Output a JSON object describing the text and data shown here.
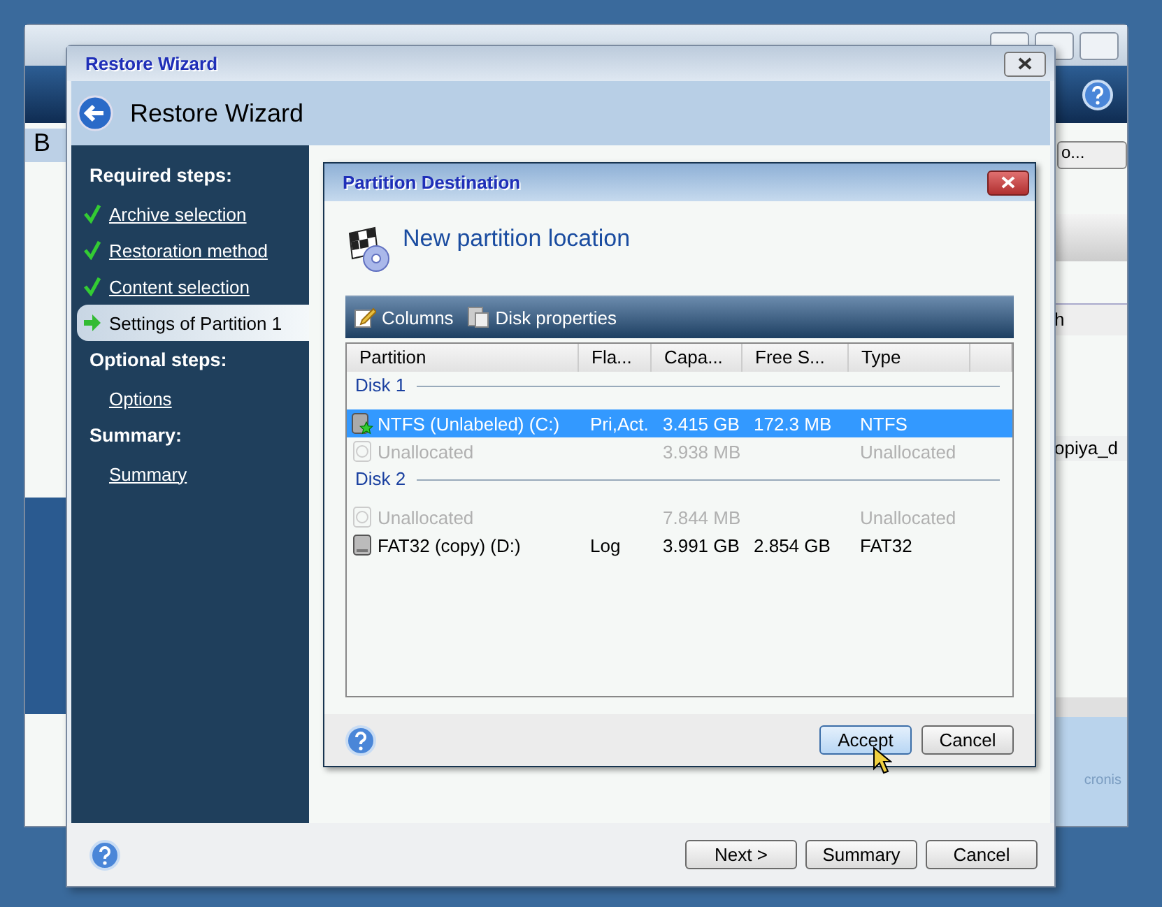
{
  "background_window": {
    "header_letter": "B",
    "button": "o...",
    "column_header": "h",
    "row_text": "opiya_d",
    "logo": "cronis"
  },
  "wizard": {
    "title": "Restore Wizard",
    "heading": "Restore Wizard",
    "sidebar": [
      {
        "kind": "section",
        "label": "Required steps:"
      },
      {
        "kind": "step",
        "label": "Archive selection",
        "done": true,
        "selected": false
      },
      {
        "kind": "step",
        "label": "Restoration method",
        "done": true,
        "selected": false
      },
      {
        "kind": "step",
        "label": "Content selection",
        "done": true,
        "selected": false
      },
      {
        "kind": "step",
        "label": "Settings of Partition 1",
        "done": false,
        "selected": true
      },
      {
        "kind": "section",
        "label": "Optional steps:"
      },
      {
        "kind": "step",
        "label": "Options",
        "done": false,
        "selected": false
      },
      {
        "kind": "section",
        "label": "Summary:"
      },
      {
        "kind": "step",
        "label": "Summary",
        "done": false,
        "selected": false
      }
    ],
    "buttons": [
      "Next >",
      "Summary",
      "Cancel"
    ]
  },
  "dialog": {
    "title": "Partition Destination",
    "heading": "New partition location",
    "toolbar": [
      "Columns",
      "Disk properties"
    ],
    "columns": [
      "Partition",
      "Fla...",
      "Capa...",
      "Free S...",
      "Type"
    ],
    "groups": [
      {
        "label": "Disk 1",
        "rows": [
          {
            "kind": "active",
            "cells": [
              "NTFS (Unlabeled) (C:)",
              "Pri,Act.",
              "3.415 GB",
              "172.3 MB",
              "NTFS"
            ],
            "selected": true,
            "disabled": false
          },
          {
            "kind": "empty",
            "cells": [
              "Unallocated",
              "",
              "3.938 MB",
              "",
              "Unallocated"
            ],
            "selected": false,
            "disabled": true
          }
        ]
      },
      {
        "label": "Disk 2",
        "rows": [
          {
            "kind": "empty",
            "cells": [
              "Unallocated",
              "",
              "7.844 MB",
              "",
              "Unallocated"
            ],
            "selected": false,
            "disabled": true
          },
          {
            "kind": "basic",
            "cells": [
              "FAT32 (copy) (D:)",
              "Log",
              "3.991 GB",
              "2.854 GB",
              "FAT32"
            ],
            "selected": false,
            "disabled": false
          }
        ]
      }
    ],
    "buttons": [
      {
        "label": "Accept",
        "focused": true
      },
      {
        "label": "Cancel",
        "focused": false
      }
    ]
  }
}
